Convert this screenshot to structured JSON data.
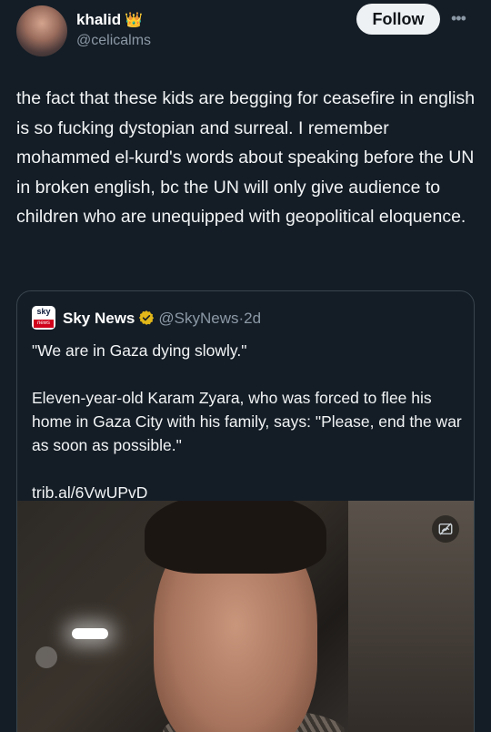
{
  "author": {
    "display_name": "khalid",
    "badge_emoji": "👑",
    "handle": "@celicalms"
  },
  "actions": {
    "follow_label": "Follow",
    "more_label": "•••"
  },
  "post": {
    "text": "the fact that these kids are begging for ceasefire in english is so fucking dystopian and surreal. I remember mohammed el-kurd's words about speaking before the UN in broken english, bc the UN will only give audience to children who are unequipped with geopolitical eloquence."
  },
  "quote": {
    "logo_top": "sky",
    "logo_bottom": "news",
    "name": "Sky News",
    "handle": "@SkyNews",
    "separator": "·",
    "time": "2d",
    "line1": "\"We are in Gaza dying slowly.\"",
    "line2": "Eleven-year-old Karam Zyara, who was forced to flee his home in Gaza City with his family, says: \"Please, end the war as soon as possible.\"",
    "link": "trib.al/6VwUPvD"
  },
  "colors": {
    "background": "#141d26",
    "secondary_text": "#8b98a5",
    "verified_gold": "#e2b719"
  },
  "icons": {
    "verified": "verified-badge-icon",
    "media_overlay": "media-crossed-icon",
    "more": "more-options-icon"
  }
}
